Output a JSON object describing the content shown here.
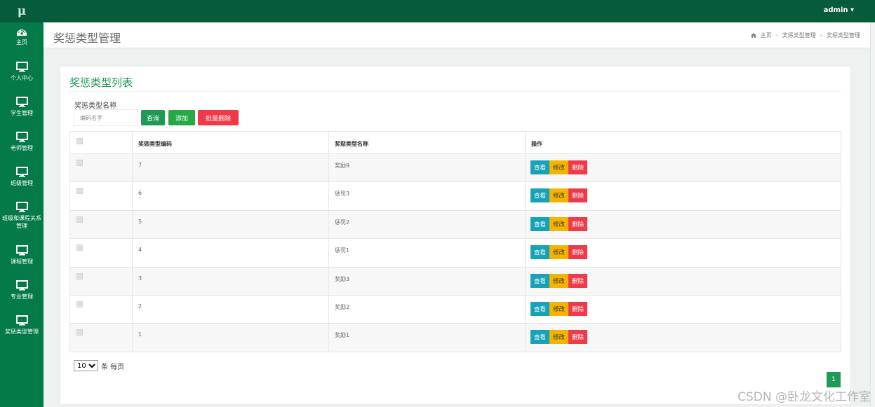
{
  "app": {
    "logo": "μ",
    "user": "admin ▾"
  },
  "sidebar": {
    "items": [
      {
        "label": "主页",
        "icon": "dashboard-icon"
      },
      {
        "label": "个人中心",
        "icon": "monitor-icon"
      },
      {
        "label": "学生管理",
        "icon": "monitor-icon"
      },
      {
        "label": "老师管理",
        "icon": "monitor-icon"
      },
      {
        "label": "班级管理",
        "icon": "monitor-icon"
      },
      {
        "label": "班级和课程关系管理",
        "icon": "monitor-icon"
      },
      {
        "label": "课程管理",
        "icon": "monitor-icon"
      },
      {
        "label": "专业管理",
        "icon": "monitor-icon"
      },
      {
        "label": "奖惩类型管理",
        "icon": "monitor-icon"
      }
    ]
  },
  "header": {
    "title": "奖惩类型管理",
    "breadcrumb": [
      "主页",
      "奖惩类型管理",
      "奖惩类型管理"
    ]
  },
  "card": {
    "title": "奖惩类型列表",
    "search_label": "奖惩类型名称",
    "search_placeholder": "编码名字",
    "buttons": {
      "query": "查询",
      "add": "添加",
      "batch_delete": "批量删除"
    }
  },
  "table": {
    "headers": [
      "奖惩类型编码",
      "奖惩类型名称",
      "操作"
    ],
    "rows": [
      {
        "code": "7",
        "name": "奖励9"
      },
      {
        "code": "6",
        "name": "惩罚3"
      },
      {
        "code": "5",
        "name": "惩罚2"
      },
      {
        "code": "4",
        "name": "惩罚1"
      },
      {
        "code": "3",
        "name": "奖励3"
      },
      {
        "code": "2",
        "name": "奖励2"
      },
      {
        "code": "1",
        "name": "奖励1"
      }
    ],
    "actions": {
      "view": "查看",
      "edit": "修改",
      "delete": "删除"
    }
  },
  "pagination": {
    "page_size": "10",
    "per_page_label": "条 每页",
    "current_page": "1"
  },
  "watermark": "CSDN @卧龙文化工作室",
  "colors": {
    "primary": "#037a48",
    "topbar": "#055b3a",
    "view": "#17a2b8",
    "edit": "#f4b400",
    "delete": "#ef3b49"
  }
}
